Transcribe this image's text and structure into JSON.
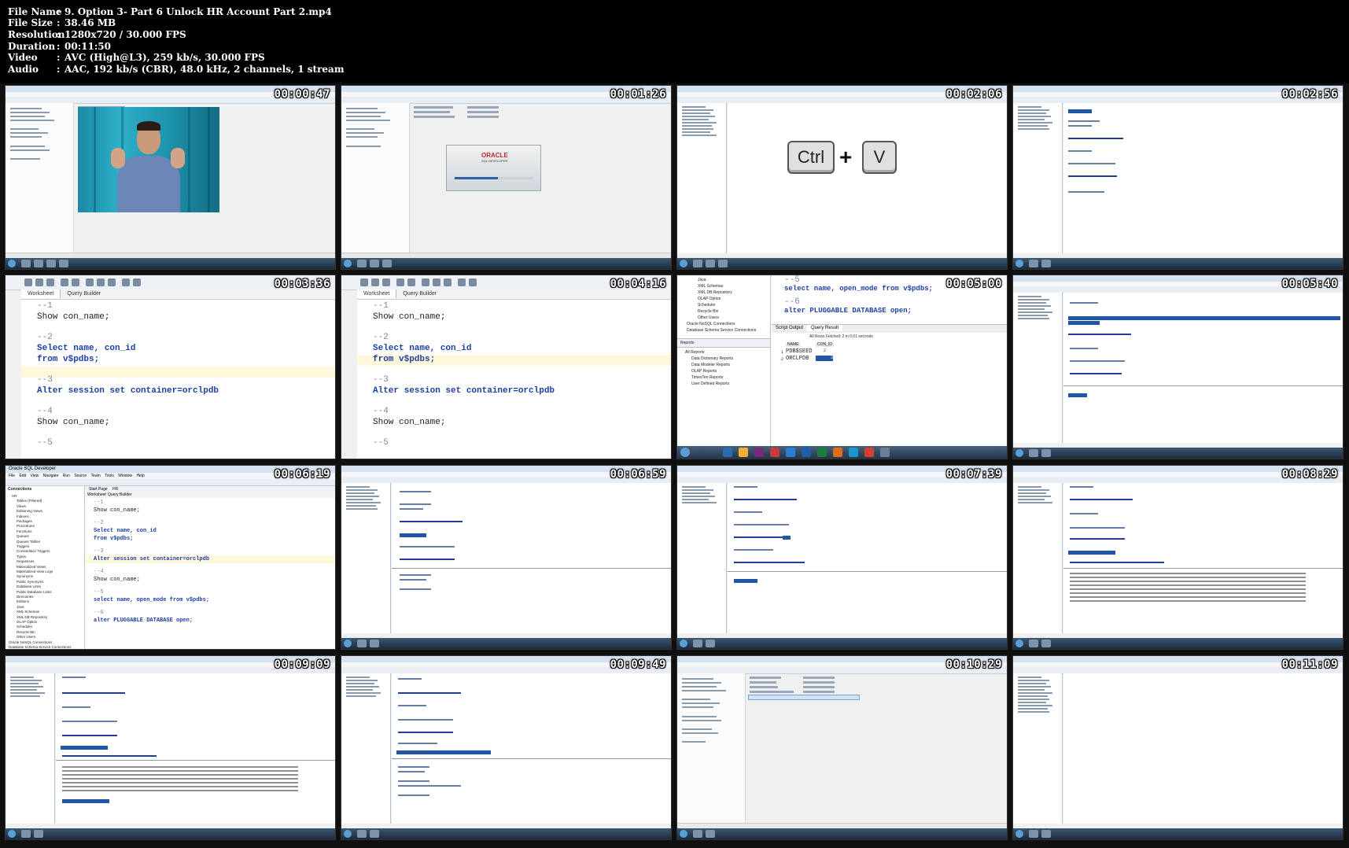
{
  "header": {
    "rows": [
      {
        "key": "File Name",
        "value": "9. Option 3- Part 6  Unlock HR Account Part 2.mp4"
      },
      {
        "key": "File Size",
        "value": "38.46 MB"
      },
      {
        "key": "Resolution",
        "value": "1280x720 / 30.000 FPS"
      },
      {
        "key": "Duration",
        "value": "00:11:50"
      },
      {
        "key": "Video",
        "value": "AVC (High@L3), 259 kb/s, 30.000 FPS"
      },
      {
        "key": "Audio",
        "value": "AAC, 192 kb/s (CBR), 48.0 kHz, 2 channels, 1 stream"
      }
    ],
    "separator": ":"
  },
  "tiles": [
    {
      "timestamp": "00:00:47"
    },
    {
      "timestamp": "00:01:26"
    },
    {
      "timestamp": "00:02:06"
    },
    {
      "timestamp": "00:02:56"
    },
    {
      "timestamp": "00:03:36"
    },
    {
      "timestamp": "00:04:16"
    },
    {
      "timestamp": "00:05:00"
    },
    {
      "timestamp": "00:05:40"
    },
    {
      "timestamp": "00:06:19"
    },
    {
      "timestamp": "00:06:59"
    },
    {
      "timestamp": "00:07:39"
    },
    {
      "timestamp": "00:08:29"
    },
    {
      "timestamp": "00:09:09"
    },
    {
      "timestamp": "00:09:49"
    },
    {
      "timestamp": "00:10:29"
    },
    {
      "timestamp": "00:11:09"
    }
  ],
  "tile2": {
    "splash_brand": "ORACLE",
    "splash_product": "SQL DEVELOPER"
  },
  "tile3": {
    "key1": "Ctrl",
    "plus": "+",
    "key2": "V"
  },
  "tile5": {
    "tabs": [
      "Worksheet",
      "Query Builder"
    ],
    "lines": [
      "--1",
      "Show con_name;",
      "--2",
      "Select name, con_id",
      "from v$pdbs;",
      "--3",
      "Alter session set container=orclpdb",
      "--4",
      "Show con_name;",
      "--5"
    ]
  },
  "tile6": {
    "tabs": [
      "Worksheet",
      "Query Builder"
    ],
    "lines": [
      "--1",
      "Show con_name;",
      "--2",
      "Select name, con_id",
      "from v$pdbs;",
      "--3",
      "Alter session set container=orclpdb",
      "--4",
      "Show con_name;",
      "--5"
    ]
  },
  "tile7": {
    "tree": [
      "Java",
      "XML Schemas",
      "XML DB Repository",
      "OLAP Option",
      "Scheduler",
      "Recycle Bin",
      "Other Users",
      "Oracle NoSQL Connections",
      "Database Schema Service Connections"
    ],
    "reports_title": "Reports",
    "reports": [
      "All Reports",
      "Data Dictionary Reports",
      "Data Modeler Reports",
      "OLAP Reports",
      "TimesTen Reports",
      "User Defined Reports"
    ],
    "code": [
      "--5",
      "select name, open_mode from v$pdbs;",
      "--6",
      "alter PLUGGABLE DATABASE open;"
    ],
    "result_tabs": [
      "Script Output",
      "Query Result"
    ],
    "result_info": "All Rows Fetched: 2 in 0.01 seconds",
    "columns": [
      "NAME",
      "CON_ID"
    ],
    "rows": [
      [
        "1",
        "PDB$SEED"
      ],
      [
        "2",
        "ORCLPDB"
      ]
    ],
    "row_ids": [
      "2",
      "3"
    ]
  },
  "tile9": {
    "app_title": "Oracle SQL Developer",
    "menu": [
      "File",
      "Edit",
      "View",
      "Navigate",
      "Run",
      "Source",
      "Team",
      "Tools",
      "Window",
      "Help"
    ],
    "panel_title": "Connections",
    "tabs": [
      "Start Page",
      "HR"
    ],
    "subtabs": [
      "Worksheet",
      "Query Builder"
    ],
    "tree": [
      "HR",
      "Tables (Filtered)",
      "Views",
      "Editioning Views",
      "Indexes",
      "Packages",
      "Procedures",
      "Functions",
      "Queues",
      "Queues Tables",
      "Triggers",
      "Crossedition Triggers",
      "Types",
      "Sequences",
      "Materialized Views",
      "Materialized View Logs",
      "Synonyms",
      "Public Synonyms",
      "Database Links",
      "Public Database Links",
      "Directories",
      "Editions",
      "Java",
      "XML Schemas",
      "XML DB Repository",
      "OLAP Option",
      "Scheduler",
      "Recycle Bin",
      "Other Users",
      "Oracle NoSQL Connections",
      "Database Schema Service Connections"
    ],
    "lines": [
      "--1",
      "Show con_name;",
      "--2",
      "Select name, con_id",
      "from v$pdbs;",
      "--3",
      "Alter session set container=orclpdb",
      "--4",
      "Show con_name;",
      "--5",
      "select name, open_mode from v$pdbs;",
      "--6",
      "alter PLUGGABLE DATABASE open;"
    ]
  }
}
